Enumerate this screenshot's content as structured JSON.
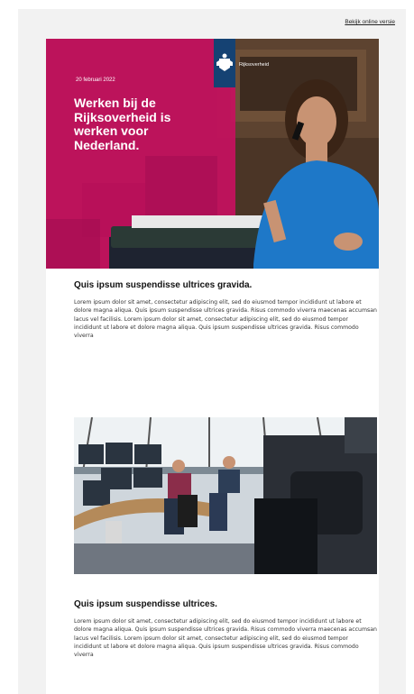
{
  "header": {
    "online_link": "Bekijk online versie"
  },
  "hero": {
    "date": "20 februari 2022",
    "title": "Werken bij de Rijksoverheid is werken voor Nederland.",
    "logo_text": "Rijksoverheid",
    "logo_color": "#154273",
    "accent_color": "#c6105f"
  },
  "articles": [
    {
      "title": "Quis ipsum suspendisse ultrices gravida.",
      "body": "Lorem ipsum dolor sit amet, consectetur adipiscing elit, sed do eiusmod tempor incididunt ut labore et dolore magna aliqua. Quis ipsum suspendisse ultrices gravida. Risus commodo viverra maecenas accumsan lacus vel facilisis. Lorem ipsum dolor sit amet, consectetur adipiscing elit, sed do eiusmod tempor incididunt ut labore et dolore magna aliqua. Quis ipsum suspendisse ultrices gravida. Risus commodo viverra"
    },
    {
      "title": "Quis ipsum suspendisse ultrices.",
      "body": "Lorem ipsum dolor sit amet, consectetur adipiscing elit, sed do eiusmod tempor incididunt ut labore et dolore magna aliqua. Quis ipsum suspendisse ultrices gravida. Risus commodo viverra maecenas accumsan lacus vel facilisis. Lorem ipsum dolor sit amet, consectetur adipiscing elit, sed do eiusmod tempor incididunt ut labore et dolore magna aliqua. Quis ipsum suspendisse ultrices gravida. Risus commodo viverra"
    }
  ]
}
